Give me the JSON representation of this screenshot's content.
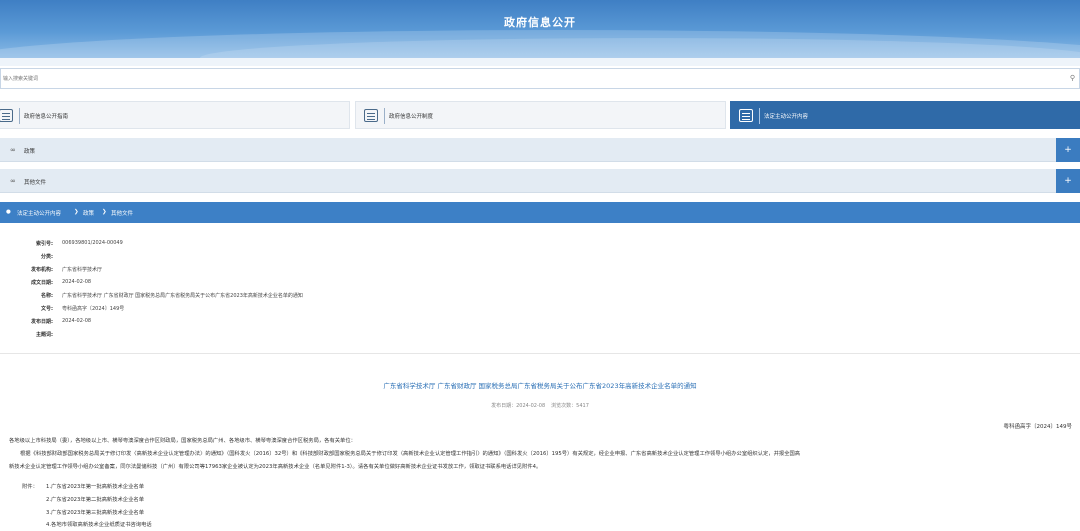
{
  "banner": {
    "title": "政府信息公开"
  },
  "search": {
    "placeholder": "输入搜索关键词"
  },
  "tabs": [
    {
      "label": "政府信息公开指南"
    },
    {
      "label": "政府信息公开制度"
    },
    {
      "label": "法定主动公开内容"
    }
  ],
  "accordion": [
    {
      "label": "政策",
      "expand": "+"
    },
    {
      "label": "其他文件",
      "expand": "+"
    }
  ],
  "breadcrumb": {
    "items": [
      "法定主动公开内容",
      "政策",
      "其他文件"
    ]
  },
  "meta": {
    "index_label": "索引号:",
    "index_value": "006939801/2024-00049",
    "category_label": "分类:",
    "category_value": "",
    "publisher_label": "发布机构:",
    "publisher_value": "广东省科学技术厅",
    "created_label": "成文日期:",
    "created_value": "2024-02-08",
    "name_label": "名称:",
    "name_value": "广东省科学技术厅 广东省财政厅 国家税务总局广东省税务局关于公布广东省2023年高新技术企业名单的通知",
    "docno_label": "文号:",
    "docno_value": "粤科函高字〔2024〕149号",
    "pubdate_label": "发布日期:",
    "pubdate_value": "2024-02-08",
    "topic_label": "主题词:",
    "topic_value": ""
  },
  "article": {
    "title": "广东省科学技术厅 广东省财政厅 国家税务总局广东省税务局关于公布广东省2023年高新技术企业名单的通知",
    "date_text": "发布日期：2024-02-08",
    "views_text": "浏览次数：5417",
    "doc_number": "粤科函高字〔2024〕149号",
    "para1": "各地级以上市科技局（委），各地级以上市、横琴粤澳深度合作区财政局，国家税务总局广州、各地级市、横琴粤澳深度合作区税务局，各有关单位：",
    "para2": "根据《科技部财政部国家税务总局关于修订印发〈高新技术企业认定管理办法〉的通知》（国科发火〔2016〕32号）和《科技部财政部国家税务总局关于修订印发〈高新技术企业认定管理工作指引〉的通知》（国科发火〔2016〕195号）有关规定，经企业申报、广东省高新技术企业认定管理工作领导小组办公室组织认定，并报全国高",
    "para3": "新技术企业认定管理工作领导小组办公室备案，同尔法曼储科技（广州）有限公司等17963家企业被认定为2023年高新技术企业（名单见附件1-3）。请各有关单位做好高新技术企业证书发放工作，领取证书联系电话详见附件4。",
    "attachments_label": "附件：",
    "attachments": [
      "1.广东省2023年第一批高新技术企业名单",
      "2.广东省2023年第二批高新技术企业名单",
      "3.广东省2023年第三批高新技术企业名单",
      "4.各地市领取高新技术企业纸质证书咨询电话"
    ]
  },
  "colors": {
    "accent": "#3d80c6",
    "active_tab": "#2f6aa8",
    "title_link": "#2a6fb5"
  }
}
